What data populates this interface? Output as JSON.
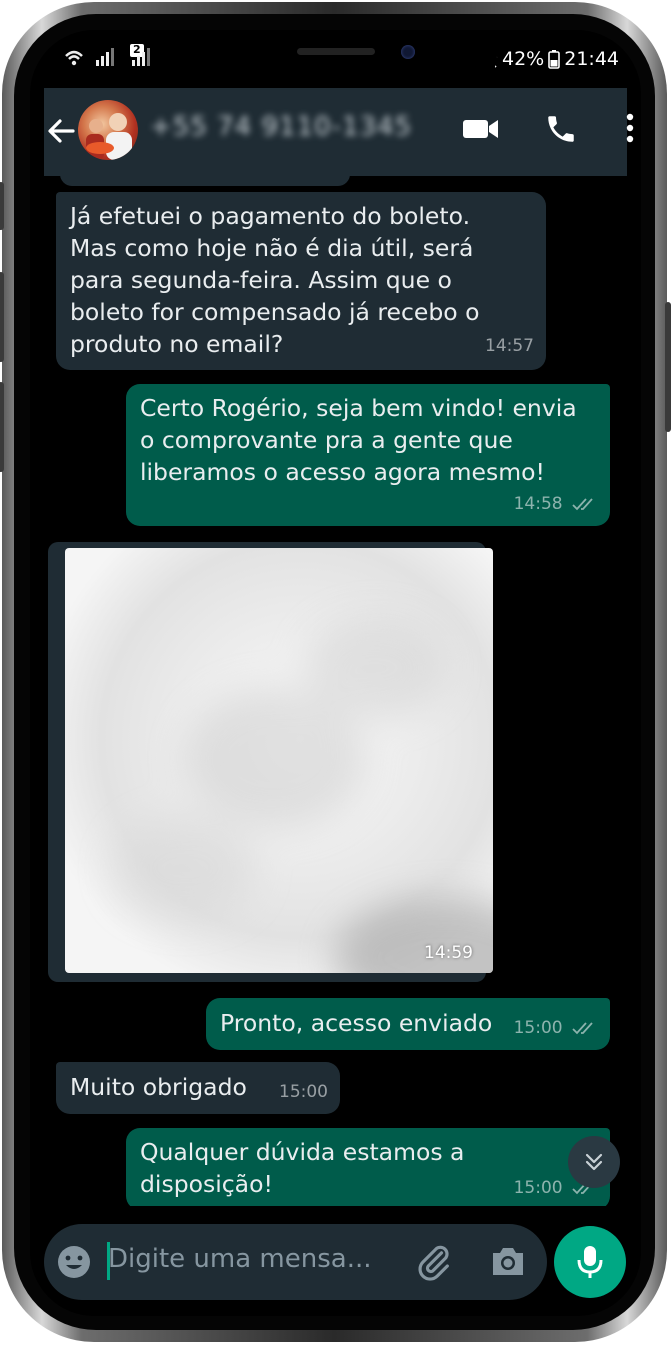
{
  "status_bar": {
    "battery": "42%",
    "time": "21:44",
    "sim_badge": "2"
  },
  "header": {
    "contact_name": "+55 74 9110-1345"
  },
  "messages": [
    {
      "direction": "in",
      "text_lines": [
        "Já efetuei o pagamento do boleto.",
        "Mas como hoje não é dia útil, será",
        "para segunda-feira. Assim que o",
        "boleto for compensado já recebo o",
        "produto no email?"
      ],
      "time": "14:57"
    },
    {
      "direction": "out",
      "text_lines": [
        "Certo Rogério, seja bem vindo! envia",
        "o comprovante pra a gente que",
        "liberamos o acesso agora mesmo!"
      ],
      "time": "14:58",
      "status": "read"
    },
    {
      "direction": "in",
      "type": "image",
      "time": "14:59"
    },
    {
      "direction": "out",
      "text_lines": [
        "Pronto, acesso enviado"
      ],
      "time": "15:00",
      "status": "read"
    },
    {
      "direction": "in",
      "text_lines": [
        "Muito obrigado"
      ],
      "time": "15:00"
    },
    {
      "direction": "out",
      "text_lines": [
        "Qualquer dúvida estamos a",
        "disposição!"
      ],
      "time": "15:00",
      "status": "read"
    }
  ],
  "composer": {
    "placeholder": "Digite uma mensa..."
  },
  "colors": {
    "incoming_bubble": "#1f2c34",
    "outgoing_bubble": "#005c4b",
    "accent": "#00a884",
    "header": "#1f2c34"
  },
  "icons": [
    "back-arrow-icon",
    "video-call-icon",
    "voice-call-icon",
    "more-options-icon",
    "emoji-icon",
    "attach-icon",
    "camera-icon",
    "mic-icon",
    "scroll-down-icon",
    "double-check-icon"
  ]
}
